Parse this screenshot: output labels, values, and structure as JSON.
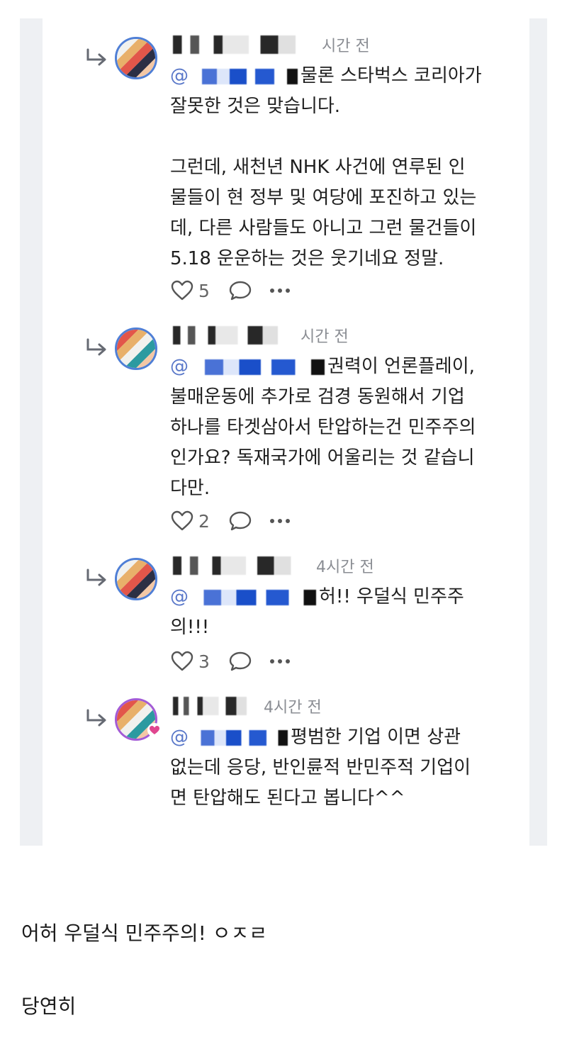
{
  "comments": [
    {
      "time": "시간 전",
      "mention_prefix": "@",
      "text": "물론 스타벅스 코리아가 잘못한 것은 맞습니다.\n\n그런데, 새천년 NHK 사건에 연루된 인물들이 현 정부 및 여당에 포진하고 있는데, 다른 사람들도 아니고 그런 물건들이 5.18 운운하는 것은 웃기네요 정말.",
      "likes": "5"
    },
    {
      "time": "시간 전",
      "mention_prefix": "@",
      "text": "권력이 언론플레이, 불매운동에 추가로 검경 동원해서 기업 하나를 타겟삼아서 탄압하는건 민주주의인가요? 독재국가에 어울리는 것 같습니다만.",
      "likes": "2"
    },
    {
      "time": "4시간 전",
      "mention_prefix": "@",
      "text": "허!! 우덜식 민주주의!!!",
      "likes": "3"
    },
    {
      "time": "4시간 전",
      "mention_prefix": "@",
      "text": "평범한 기업 이면 상관없는데 응당, 반인륜적 반민주적 기업이면 탄압해도 된다고 봅니다^^"
    }
  ],
  "post": {
    "line1": "어허 우덜식 민주주의! ㅇㅈㄹ",
    "line2": "당연히"
  },
  "icons": {
    "reply": "reply-arrow-icon",
    "like": "heart-icon",
    "comment": "speech-bubble-icon",
    "more": "more-dots-icon"
  },
  "colors": {
    "panel_bg": "#eef0f3",
    "mention": "#5a78c9",
    "avatar_ring": "#4f7fd6",
    "avatar_ring_special": "#a35bd6",
    "badge": "#e0468f"
  }
}
